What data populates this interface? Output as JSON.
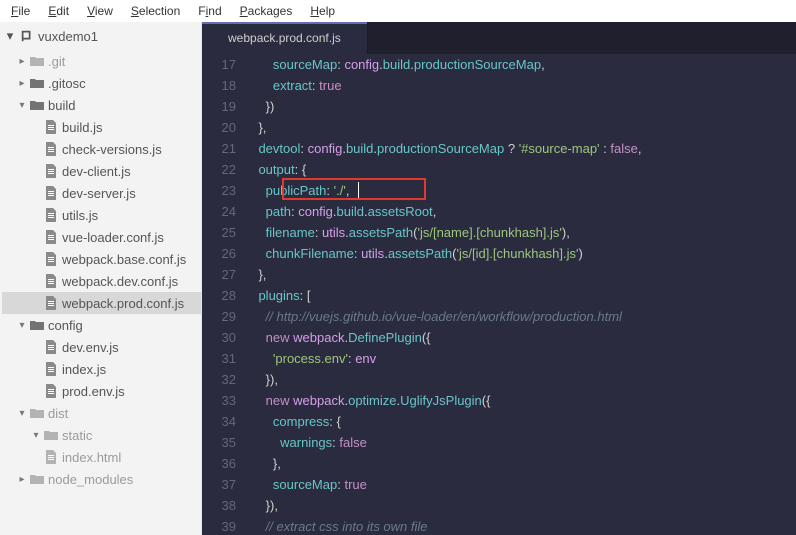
{
  "menubar": {
    "file": "File",
    "edit": "Edit",
    "view": "View",
    "selection": "Selection",
    "find": "Find",
    "packages": "Packages",
    "help": "Help"
  },
  "project": {
    "name": "vuxdemo1"
  },
  "tree": {
    "git": ".git",
    "gitosc": ".gitosc",
    "build": "build",
    "build_children": {
      "buildjs": "build.js",
      "checkversions": "check-versions.js",
      "devclient": "dev-client.js",
      "devserver": "dev-server.js",
      "utils": "utils.js",
      "vueloader": "vue-loader.conf.js",
      "webpackbase": "webpack.base.conf.js",
      "webpackdev": "webpack.dev.conf.js",
      "webpackprod": "webpack.prod.conf.js"
    },
    "config": "config",
    "config_children": {
      "devenv": "dev.env.js",
      "index": "index.js",
      "prodenv": "prod.env.js"
    },
    "dist": "dist",
    "static": "static",
    "indexhtml": "index.html",
    "node_modules": "node_modules"
  },
  "tab": {
    "title": "webpack.prod.conf.js"
  },
  "code": {
    "l17": {
      "ind": "        ",
      "k": "sourceMap",
      "colon": ": ",
      "a": "config",
      "d1": ".",
      "b": "build",
      "d2": ".",
      "c": "productionSourceMap",
      "end": ","
    },
    "l18": {
      "ind": "        ",
      "k": "extract",
      "colon": ": ",
      "v": "true"
    },
    "l19": {
      "ind": "      ",
      "v": "})"
    },
    "l20": {
      "ind": "    ",
      "v": "},"
    },
    "l21": {
      "ind": "    ",
      "k": "devtool",
      "colon": ": ",
      "a": "config",
      "d1": ".",
      "b": "build",
      "d2": ".",
      "c": "productionSourceMap",
      "q": " ? ",
      "s": "'#source-map'",
      "t": " : ",
      "f": "false",
      "end": ","
    },
    "l22": {
      "ind": "    ",
      "k": "output",
      "colon": ": ",
      "brace": "{"
    },
    "l23": {
      "ind": "      ",
      "k": "publicPath",
      "colon": ": ",
      "s": "'./'",
      "end": ","
    },
    "l24": {
      "ind": "      ",
      "k": "path",
      "colon": ": ",
      "a": "config",
      "d1": ".",
      "b": "build",
      "d2": ".",
      "c": "assetsRoot",
      "end": ","
    },
    "l25": {
      "ind": "      ",
      "k": "filename",
      "colon": ": ",
      "a": "utils",
      "d1": ".",
      "b": "assetsPath",
      "p1": "(",
      "s": "'js/[name].[chunkhash].js'",
      "p2": ")",
      "end": ","
    },
    "l26": {
      "ind": "      ",
      "k": "chunkFilename",
      "colon": ": ",
      "a": "utils",
      "d1": ".",
      "b": "assetsPath",
      "p1": "(",
      "s": "'js/[id].[chunkhash].js'",
      "p2": ")"
    },
    "l27": {
      "ind": "    ",
      "v": "},"
    },
    "l28": {
      "ind": "    ",
      "k": "plugins",
      "colon": ": ",
      "v": "["
    },
    "l29": {
      "ind": "      ",
      "cmt": "// http://vuejs.github.io/vue-loader/en/workflow/production.html"
    },
    "l30": {
      "ind": "      ",
      "kw": "new",
      "sp": " ",
      "a": "webpack",
      "d1": ".",
      "b": "DefinePlugin",
      "p1": "({"
    },
    "l31": {
      "ind": "        ",
      "s": "'process.env'",
      "colon": ": ",
      "v": "env"
    },
    "l32": {
      "ind": "      ",
      "v": "}),"
    },
    "l33": {
      "ind": "      ",
      "kw": "new",
      "sp": " ",
      "a": "webpack",
      "d1": ".",
      "b": "optimize",
      "d2": ".",
      "c": "UglifyJsPlugin",
      "p1": "({"
    },
    "l34": {
      "ind": "        ",
      "k": "compress",
      "colon": ": ",
      "v": "{"
    },
    "l35": {
      "ind": "          ",
      "k": "warnings",
      "colon": ": ",
      "v": "false"
    },
    "l36": {
      "ind": "        ",
      "v": "},"
    },
    "l37": {
      "ind": "        ",
      "k": "sourceMap",
      "colon": ": ",
      "v": "true"
    },
    "l38": {
      "ind": "      ",
      "v": "}),"
    },
    "l39": {
      "ind": "      ",
      "cmt": "// extract css into its own file"
    }
  },
  "lineNumbers": [
    "17",
    "18",
    "19",
    "20",
    "21",
    "22",
    "23",
    "24",
    "25",
    "26",
    "27",
    "28",
    "29",
    "30",
    "31",
    "32",
    "33",
    "34",
    "35",
    "36",
    "37",
    "38",
    "39"
  ],
  "highlight": {
    "line": 23
  },
  "colors": {
    "highlight_border": "#e03a2f"
  }
}
